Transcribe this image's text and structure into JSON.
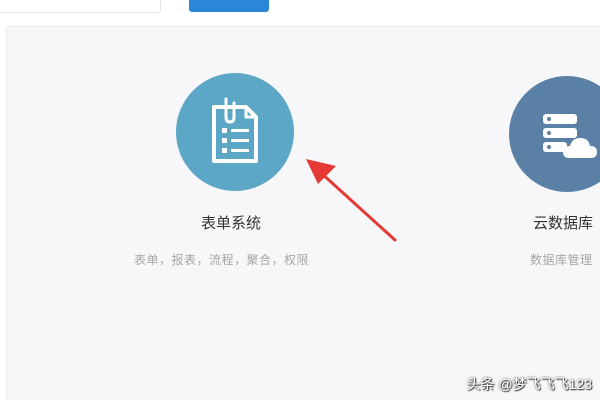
{
  "topbar": {
    "search_placeholder": "",
    "primary_button_label": ""
  },
  "cards": [
    {
      "title": "表单系统",
      "description": "表单，报表，流程，聚合，权限",
      "icon": "form-document-icon",
      "color": "#5ca7c6"
    },
    {
      "title": "云数据库",
      "description": "数据库管理",
      "icon": "cloud-database-icon",
      "color": "#5b80a5"
    }
  ],
  "annotation": {
    "arrow_color": "#e53935"
  },
  "watermark": {
    "text": "头条 @梦飞飞飞123"
  }
}
